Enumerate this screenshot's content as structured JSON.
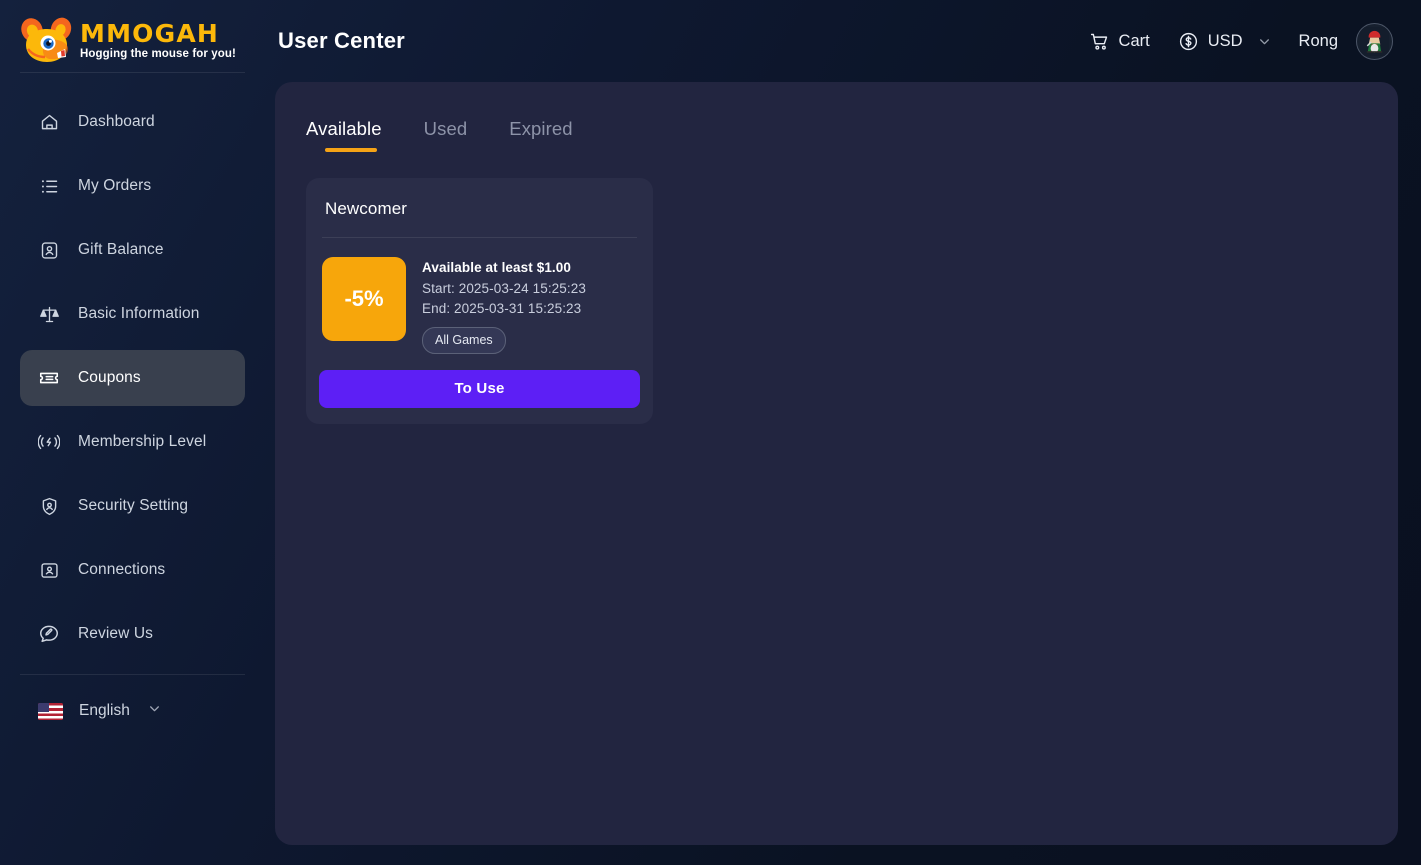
{
  "brand": {
    "name": "MMOGAH",
    "tagline": "Hogging the mouse for you!",
    "logo_color": "#fcb80a"
  },
  "header": {
    "title": "User Center",
    "cart_label": "Cart",
    "currency_label": "USD",
    "user_name": "Rong",
    "icons": {
      "cart": "cart-icon",
      "currency": "dollar-circle-icon",
      "chevron": "chevron-down-icon",
      "avatar": "avatar"
    }
  },
  "sidebar": {
    "items": [
      {
        "label": "Dashboard",
        "icon": "home-icon",
        "active": false
      },
      {
        "label": "My Orders",
        "icon": "list-icon",
        "active": false
      },
      {
        "label": "Gift Balance",
        "icon": "gift-card-icon",
        "active": false
      },
      {
        "label": "Basic Information",
        "icon": "scales-icon",
        "active": false
      },
      {
        "label": "Coupons",
        "icon": "ticket-icon",
        "active": true
      },
      {
        "label": "Membership Level",
        "icon": "broadcast-icon",
        "active": false
      },
      {
        "label": "Security Setting",
        "icon": "shield-user-icon",
        "active": false
      },
      {
        "label": "Connections",
        "icon": "id-card-icon",
        "active": false
      },
      {
        "label": "Review Us",
        "icon": "chat-edit-icon",
        "active": false
      }
    ],
    "language": {
      "label": "English",
      "flag": "us-flag-icon",
      "chevron": "chevron-down-icon"
    },
    "active_bg": "#39404e"
  },
  "main": {
    "tabs": [
      {
        "label": "Available",
        "active": true
      },
      {
        "label": "Used",
        "active": false
      },
      {
        "label": "Expired",
        "active": false
      }
    ],
    "tab_underline_color": "#f5a316",
    "coupons": [
      {
        "title": "Newcomer",
        "discount": "-5%",
        "discount_bg": "#f7a60b",
        "condition": "Available at least $1.00",
        "start": "Start: 2025-03-24 15:25:23",
        "end": "End: 2025-03-31 15:25:23",
        "scope_tag": "All Games",
        "action_label": "To Use",
        "action_bg": "#5d1ff5"
      }
    ]
  }
}
